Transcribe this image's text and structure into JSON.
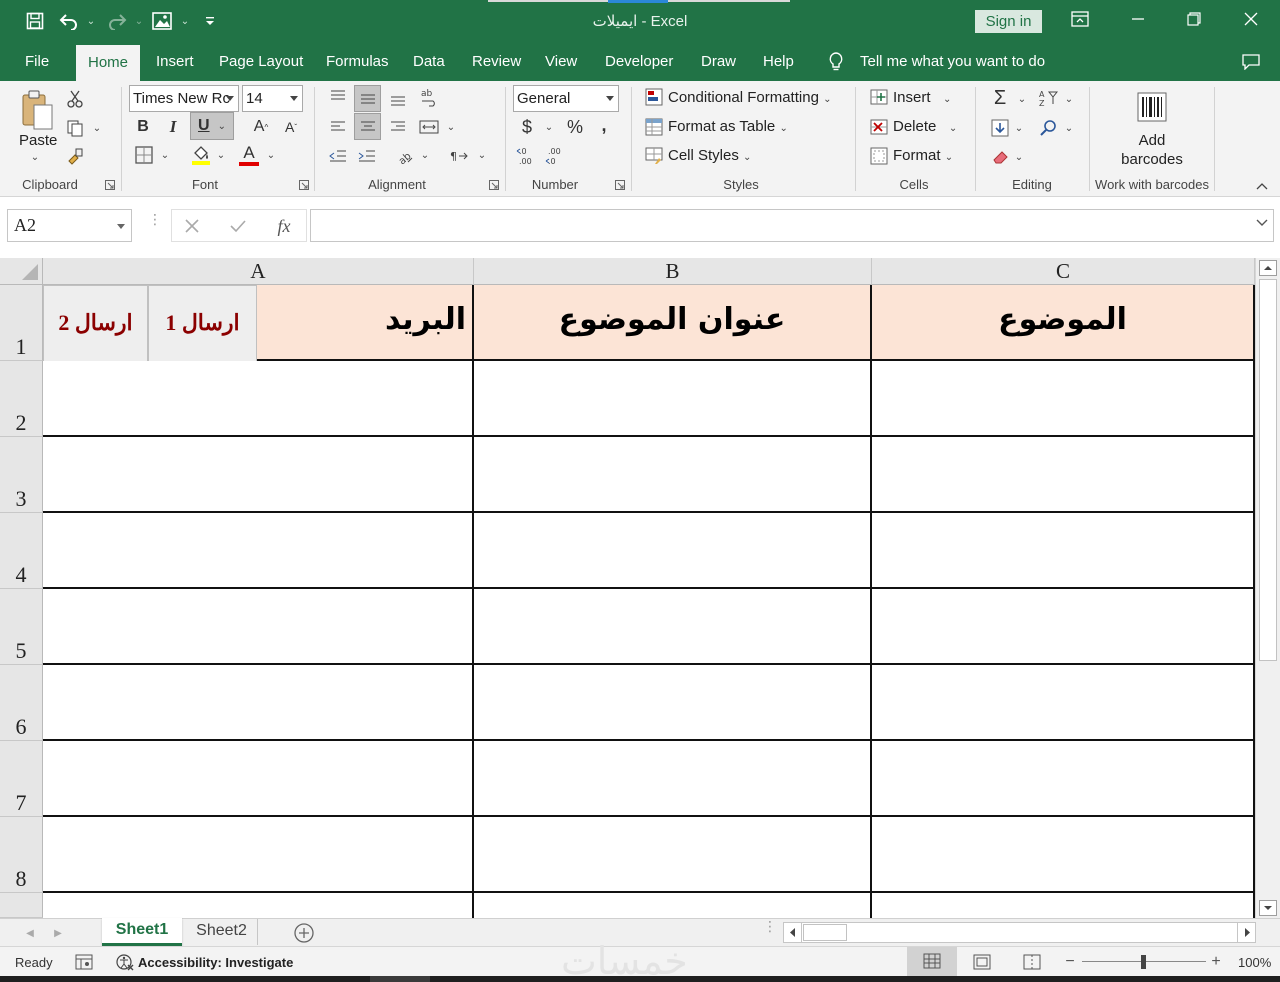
{
  "window": {
    "title": "ايميلات  -  Excel",
    "sign_in": "Sign in"
  },
  "tabs": [
    "File",
    "Home",
    "Insert",
    "Page Layout",
    "Formulas",
    "Data",
    "Review",
    "View",
    "Developer",
    "Draw",
    "Help"
  ],
  "tell_me": "Tell me what you want to do",
  "ribbon": {
    "clipboard": {
      "paste": "Paste",
      "label": "Clipboard"
    },
    "font": {
      "name": "Times New Rc",
      "size": "14",
      "bold": "B",
      "italic": "I",
      "underline": "U",
      "grow": "A",
      "shrink": "A",
      "font_color": "A",
      "label": "Font"
    },
    "alignment": {
      "label": "Alignment"
    },
    "number": {
      "format": "General",
      "currency": "$",
      "percent": "%",
      "comma": ",",
      "label": "Number"
    },
    "styles": {
      "conditional": "Conditional Formatting",
      "format_table": "Format as Table",
      "cell_styles": "Cell Styles",
      "label": "Styles"
    },
    "cells": {
      "insert": "Insert",
      "delete": "Delete",
      "format": "Format",
      "label": "Cells"
    },
    "editing": {
      "label": "Editing"
    },
    "barcodes": {
      "line1": "Add",
      "line2": "barcodes",
      "label": "Work with barcodes"
    }
  },
  "formula_bar": {
    "name_box": "A2",
    "fx": "fx",
    "value": ""
  },
  "grid": {
    "columns": [
      "A",
      "B",
      "C"
    ],
    "rows": [
      "1",
      "2",
      "3",
      "4",
      "5",
      "6",
      "7",
      "8"
    ],
    "header_row": {
      "A": "البريد",
      "B": "عنوان الموضوع",
      "C": "الموضوع"
    },
    "buttons": {
      "send1": "ارسال 1",
      "send2": "ارسال 2"
    }
  },
  "sheets": [
    "Sheet1",
    "Sheet2"
  ],
  "active_sheet": "Sheet1",
  "status": {
    "ready": "Ready",
    "accessibility": "Accessibility: Investigate",
    "zoom": "100%"
  },
  "colors": {
    "excel_green": "#217346",
    "header_fill": "#fce4d6",
    "button_text": "#8b0000"
  }
}
